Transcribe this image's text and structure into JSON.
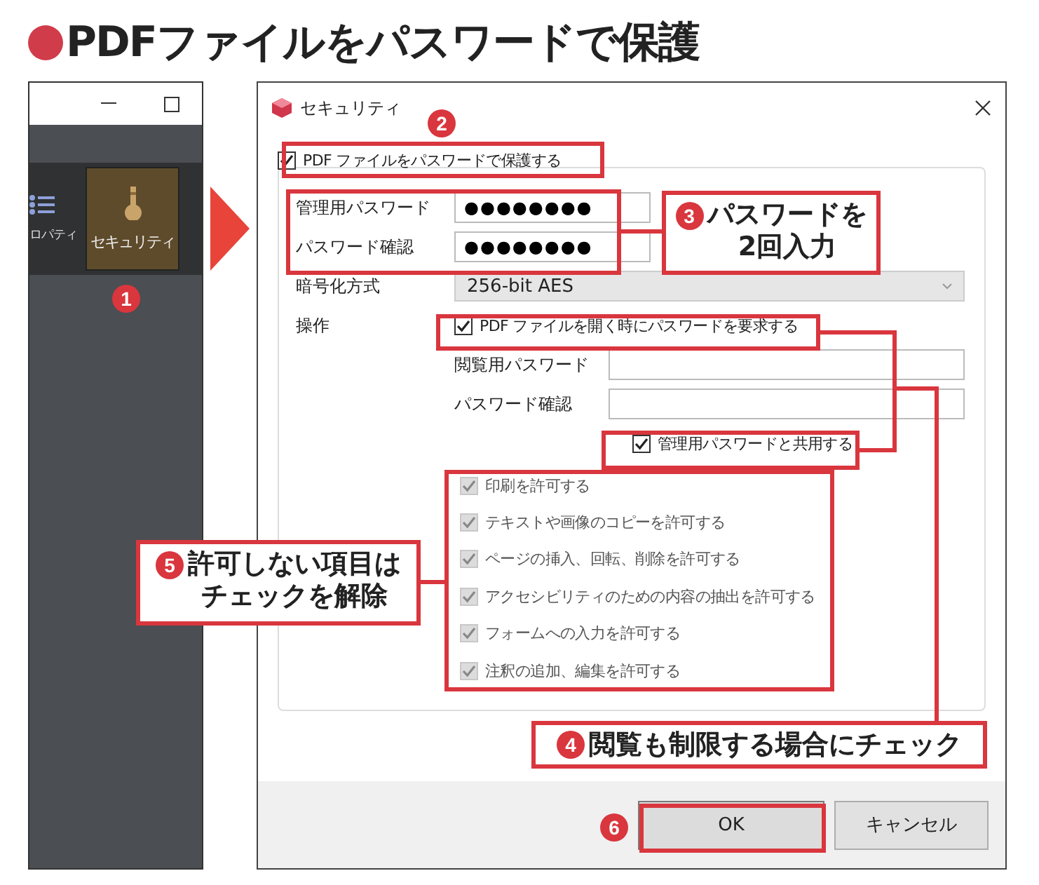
{
  "heading": "PDFファイルをパスワードで保護",
  "app_panel": {
    "partial_label": "ロパティ",
    "security_button": {
      "label": "セキュリティ",
      "selected": true
    }
  },
  "dialog": {
    "title": "セキュリティ",
    "protect": {
      "label": "PDF ファイルをパスワードで保護する",
      "checked": true
    },
    "fields": [
      {
        "label": "管理用パスワード",
        "value": "●●●●●●●●"
      },
      {
        "label": "パスワード確認",
        "value": "●●●●●●●●"
      }
    ],
    "encryption": {
      "label": "暗号化方式",
      "value": "256-bit AES"
    },
    "operation_label": "操作",
    "open_password": {
      "label": "PDF ファイルを開く時にパスワードを要求する",
      "checked": true
    },
    "open_fields": [
      {
        "label": "閲覧用パスワード"
      },
      {
        "label": "パスワード確認"
      }
    ],
    "share": {
      "label": "管理用パスワードと共用する",
      "checked": true
    },
    "permissions": [
      {
        "label": "印刷を許可する",
        "checked": true,
        "disabled": true
      },
      {
        "label": "テキストや画像のコピーを許可する",
        "checked": true,
        "disabled": true
      },
      {
        "label": "ページの挿入、回転、削除を許可する",
        "checked": true,
        "disabled": true
      },
      {
        "label": "アクセシビリティのための内容の抽出を許可する",
        "checked": true,
        "disabled": true
      },
      {
        "label": "フォームへの入力を許可する",
        "checked": true,
        "disabled": true
      },
      {
        "label": "注釈の追加、編集を許可する",
        "checked": true,
        "disabled": true
      }
    ],
    "buttons": [
      {
        "label": "OK",
        "kind": "default"
      },
      {
        "label": "キャンセル",
        "kind": "normal"
      }
    ]
  },
  "annotations": [
    {
      "kind": "badge",
      "number": "1"
    },
    {
      "kind": "badge",
      "number": "2"
    },
    {
      "kind": "callout",
      "number": "3",
      "lines": [
        "パスワードを",
        "2回入力"
      ]
    },
    {
      "kind": "callout",
      "number": "4",
      "lines": [
        "閲覧も制限する場合にチェック"
      ]
    },
    {
      "kind": "callout",
      "number": "5",
      "lines": [
        "許可しない項目は",
        "チェックを解除"
      ]
    },
    {
      "kind": "badge",
      "number": "6"
    }
  ]
}
